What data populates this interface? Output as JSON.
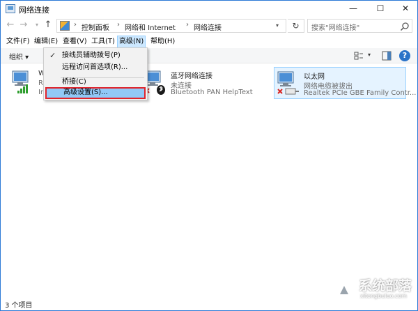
{
  "window": {
    "title": "网络连接",
    "controls": {
      "minimize": "—",
      "maximize": "☐",
      "close": "✕"
    }
  },
  "address": {
    "crumbs": [
      "控制面板",
      "网络和 Internet",
      "网络连接"
    ],
    "separator": "›",
    "search_placeholder": "搜索\"网络连接\""
  },
  "menubar": {
    "items": [
      "文件(F)",
      "编辑(E)",
      "查看(V)",
      "工具(T)",
      "高级(N)",
      "帮助(H)"
    ],
    "active": "高级(N)"
  },
  "commandbar": {
    "organize_label": "组织 ▾"
  },
  "connections": [
    {
      "name": "W",
      "status": "R",
      "device": "In",
      "icon": "wifi-network-icon"
    },
    {
      "name": "蓝牙网络连接",
      "status": "未连接",
      "device": "Bluetooth PAN HelpText",
      "icon": "bluetooth-network-icon"
    },
    {
      "name": "以太网",
      "status": "网络电缆被拔出",
      "device": "Realtek PCIe GBE Family Contr...",
      "icon": "ethernet-network-icon"
    }
  ],
  "advanced_menu": {
    "items": [
      {
        "label": "接线员辅助拨号(P)",
        "checked": true
      },
      {
        "label": "远程访问首选项(R)...",
        "checked": false
      },
      {
        "label": "桥接(C)",
        "checked": false
      },
      {
        "label": "高级设置(S)...",
        "checked": false,
        "highlighted": true
      }
    ]
  },
  "statusbar": {
    "text": "3 个项目"
  },
  "watermark": {
    "text": "系统部落",
    "sub": "xitongbuluo.com"
  },
  "colors": {
    "accent": "#2b79d6",
    "selection": "#cce8ff",
    "highlight_border": "#e0232b",
    "error_red": "#d9231f"
  }
}
